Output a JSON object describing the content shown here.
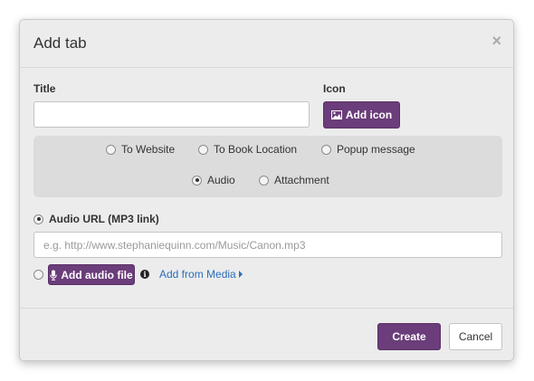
{
  "dialog": {
    "title": "Add tab",
    "close_glyph": "×"
  },
  "form": {
    "title_label": "Title",
    "title_value": "",
    "icon_label": "Icon",
    "add_icon_label": "Add icon",
    "add_icon_icon": "image-icon"
  },
  "tab_types": [
    {
      "label": "To Website",
      "checked": false
    },
    {
      "label": "To Book Location",
      "checked": false
    },
    {
      "label": "Popup message",
      "checked": false
    },
    {
      "label": "Audio",
      "checked": true
    },
    {
      "label": "Attachment",
      "checked": false
    }
  ],
  "audio": {
    "url_option_label": "Audio URL (MP3 link)",
    "url_option_checked": true,
    "url_value": "",
    "url_placeholder": "e.g. http://www.stephaniequinn.com/Music/Canon.mp3",
    "file_option_checked": false,
    "add_file_label": "Add audio file",
    "add_file_icon": "microphone-icon",
    "info_icon": "info-icon",
    "info_glyph": "i",
    "add_from_media_label": "Add from Media",
    "add_from_media_icon": "caret-right-icon"
  },
  "footer": {
    "create_label": "Create",
    "cancel_label": "Cancel"
  },
  "colors": {
    "accent": "#6b3d7a",
    "link": "#2a6ebb"
  }
}
